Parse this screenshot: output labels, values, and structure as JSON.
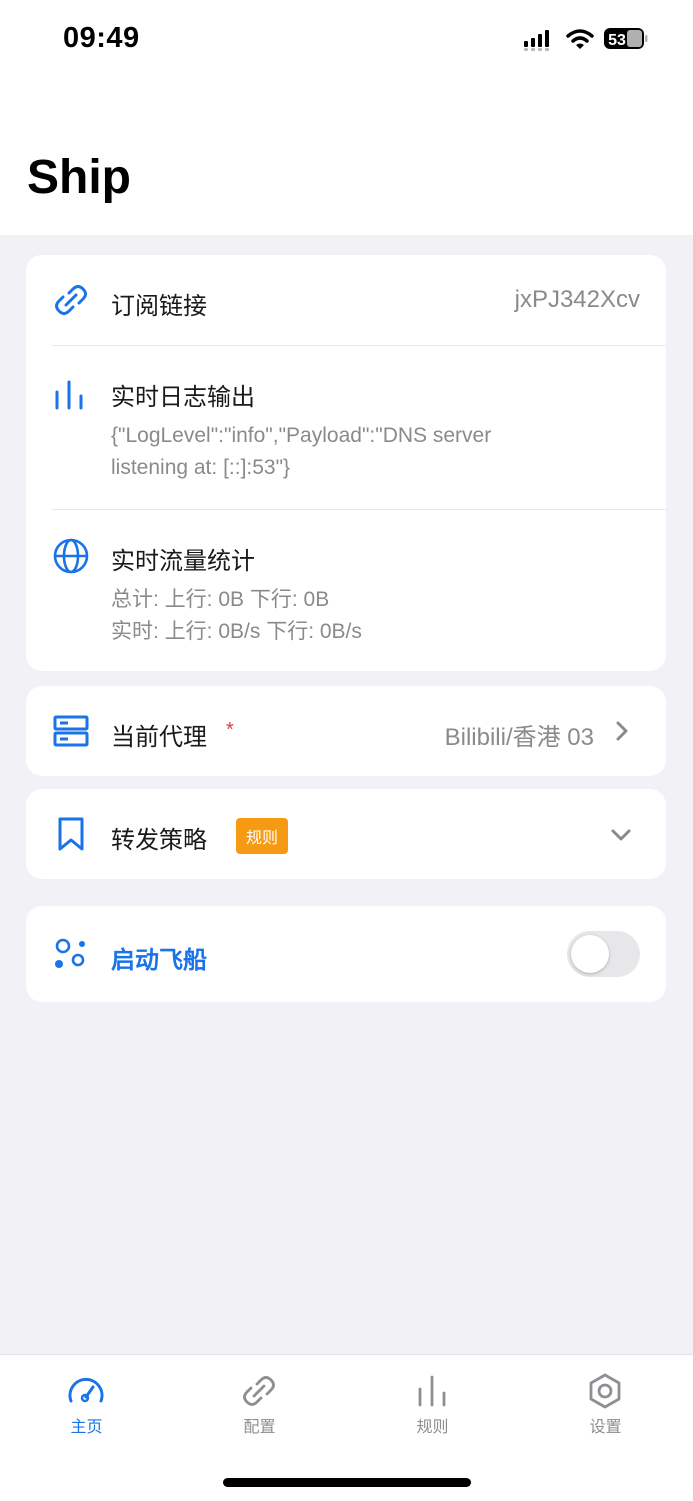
{
  "status_bar": {
    "time": "09:49",
    "battery": "53",
    "icons": [
      "signal-icon",
      "wifi-icon",
      "battery-icon"
    ]
  },
  "page": {
    "title": "Ship"
  },
  "info_card": {
    "subscription": {
      "icon": "link-icon",
      "label": "订阅链接",
      "value": "jxPJ342Xcv"
    },
    "log": {
      "icon": "bar-chart-icon",
      "label": "实时日志输出",
      "line1": "{\"LogLevel\":\"info\",\"Payload\":\"DNS server",
      "line2": "listening at: [::]:53\"}"
    },
    "traffic": {
      "icon": "globe-icon",
      "label": "实时流量统计",
      "total": "总计: 上行: 0B 下行: 0B",
      "realtime": "实时: 上行: 0B/s 下行: 0B/s"
    }
  },
  "proxy": {
    "icon": "server-icon",
    "label": "当前代理",
    "required_mark": "*",
    "value": "Bilibili/香港 03",
    "chevron": "chevron-right-icon"
  },
  "forward": {
    "icon": "bookmark-icon",
    "label": "转发策略",
    "badge": "规则",
    "chevron": "chevron-down-icon"
  },
  "launch": {
    "icon": "nodes-icon",
    "label": "启动飞船",
    "toggle_on": false
  },
  "tabbar": {
    "tabs": [
      {
        "label": "主页",
        "icon": "speedometer-icon",
        "active": true
      },
      {
        "label": "配置",
        "icon": "link-icon",
        "active": false
      },
      {
        "label": "规则",
        "icon": "bar-chart-icon",
        "active": false
      },
      {
        "label": "设置",
        "icon": "hexagon-gear-icon",
        "active": false
      }
    ]
  },
  "colors": {
    "accent": "#1a73e8",
    "badge": "#f79a13",
    "required": "#e03b3b",
    "background": "#f1f1f6"
  }
}
